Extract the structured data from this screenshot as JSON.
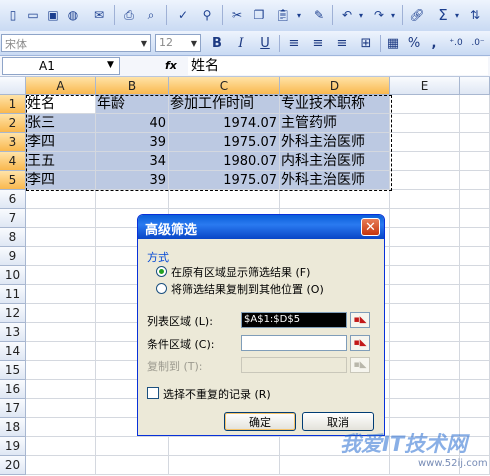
{
  "toolbar": {
    "font_name": "宋体",
    "font_size": "12",
    "bold": "B",
    "italic": "I",
    "underline": "U",
    "percent": "%",
    "comma": ",",
    "sigma": "Σ"
  },
  "formula_bar": {
    "name_box": "A1",
    "fx": "fx",
    "content": "姓名"
  },
  "columns": [
    "A",
    "B",
    "C",
    "D",
    "E"
  ],
  "rows": [
    "1",
    "2",
    "3",
    "4",
    "5",
    "6",
    "7",
    "8",
    "9",
    "10",
    "11",
    "12",
    "13",
    "14",
    "15",
    "16",
    "17",
    "18",
    "19",
    "20"
  ],
  "table": [
    [
      "姓名",
      "年龄",
      "参加工作时间",
      "专业技术职称"
    ],
    [
      "张三",
      "40",
      "1974.07",
      "主管药师"
    ],
    [
      "李四",
      "39",
      "1975.07",
      "外科主治医师"
    ],
    [
      "王五",
      "34",
      "1980.07",
      "内科主治医师"
    ],
    [
      "李四",
      "39",
      "1975.07",
      "外科主治医师"
    ]
  ],
  "dialog": {
    "title": "高级筛选",
    "mode_label": "方式",
    "option1": "在原有区域显示筛选结果 (F)",
    "option2": "将筛选结果复制到其他位置 (O)",
    "list_range_label": "列表区域 (L):",
    "list_range_value": "$A$1:$D$5",
    "criteria_range_label": "条件区域 (C):",
    "criteria_range_value": "",
    "copy_to_label": "复制到 (T):",
    "copy_to_value": "",
    "unique_label": "选择不重复的记录 (R)",
    "ok": "确定",
    "cancel": "取消"
  },
  "watermark": {
    "text": "我爱IT技术网",
    "url": "www.52ij.com"
  }
}
